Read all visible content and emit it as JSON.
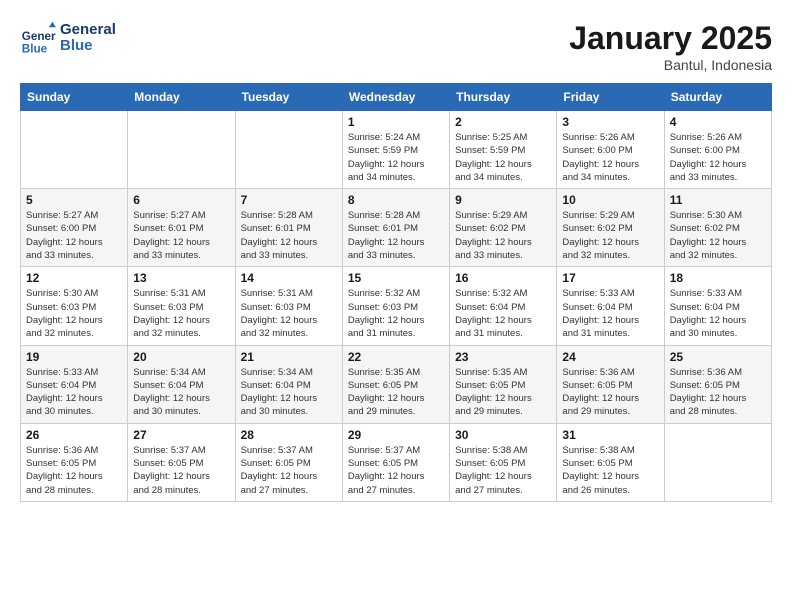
{
  "header": {
    "logo_line1": "General",
    "logo_line2": "Blue",
    "month_title": "January 2025",
    "location": "Bantul, Indonesia"
  },
  "weekdays": [
    "Sunday",
    "Monday",
    "Tuesday",
    "Wednesday",
    "Thursday",
    "Friday",
    "Saturday"
  ],
  "weeks": [
    [
      {
        "day": "",
        "info": ""
      },
      {
        "day": "",
        "info": ""
      },
      {
        "day": "",
        "info": ""
      },
      {
        "day": "1",
        "info": "Sunrise: 5:24 AM\nSunset: 5:59 PM\nDaylight: 12 hours\nand 34 minutes."
      },
      {
        "day": "2",
        "info": "Sunrise: 5:25 AM\nSunset: 5:59 PM\nDaylight: 12 hours\nand 34 minutes."
      },
      {
        "day": "3",
        "info": "Sunrise: 5:26 AM\nSunset: 6:00 PM\nDaylight: 12 hours\nand 34 minutes."
      },
      {
        "day": "4",
        "info": "Sunrise: 5:26 AM\nSunset: 6:00 PM\nDaylight: 12 hours\nand 33 minutes."
      }
    ],
    [
      {
        "day": "5",
        "info": "Sunrise: 5:27 AM\nSunset: 6:00 PM\nDaylight: 12 hours\nand 33 minutes."
      },
      {
        "day": "6",
        "info": "Sunrise: 5:27 AM\nSunset: 6:01 PM\nDaylight: 12 hours\nand 33 minutes."
      },
      {
        "day": "7",
        "info": "Sunrise: 5:28 AM\nSunset: 6:01 PM\nDaylight: 12 hours\nand 33 minutes."
      },
      {
        "day": "8",
        "info": "Sunrise: 5:28 AM\nSunset: 6:01 PM\nDaylight: 12 hours\nand 33 minutes."
      },
      {
        "day": "9",
        "info": "Sunrise: 5:29 AM\nSunset: 6:02 PM\nDaylight: 12 hours\nand 33 minutes."
      },
      {
        "day": "10",
        "info": "Sunrise: 5:29 AM\nSunset: 6:02 PM\nDaylight: 12 hours\nand 32 minutes."
      },
      {
        "day": "11",
        "info": "Sunrise: 5:30 AM\nSunset: 6:02 PM\nDaylight: 12 hours\nand 32 minutes."
      }
    ],
    [
      {
        "day": "12",
        "info": "Sunrise: 5:30 AM\nSunset: 6:03 PM\nDaylight: 12 hours\nand 32 minutes."
      },
      {
        "day": "13",
        "info": "Sunrise: 5:31 AM\nSunset: 6:03 PM\nDaylight: 12 hours\nand 32 minutes."
      },
      {
        "day": "14",
        "info": "Sunrise: 5:31 AM\nSunset: 6:03 PM\nDaylight: 12 hours\nand 32 minutes."
      },
      {
        "day": "15",
        "info": "Sunrise: 5:32 AM\nSunset: 6:03 PM\nDaylight: 12 hours\nand 31 minutes."
      },
      {
        "day": "16",
        "info": "Sunrise: 5:32 AM\nSunset: 6:04 PM\nDaylight: 12 hours\nand 31 minutes."
      },
      {
        "day": "17",
        "info": "Sunrise: 5:33 AM\nSunset: 6:04 PM\nDaylight: 12 hours\nand 31 minutes."
      },
      {
        "day": "18",
        "info": "Sunrise: 5:33 AM\nSunset: 6:04 PM\nDaylight: 12 hours\nand 30 minutes."
      }
    ],
    [
      {
        "day": "19",
        "info": "Sunrise: 5:33 AM\nSunset: 6:04 PM\nDaylight: 12 hours\nand 30 minutes."
      },
      {
        "day": "20",
        "info": "Sunrise: 5:34 AM\nSunset: 6:04 PM\nDaylight: 12 hours\nand 30 minutes."
      },
      {
        "day": "21",
        "info": "Sunrise: 5:34 AM\nSunset: 6:04 PM\nDaylight: 12 hours\nand 30 minutes."
      },
      {
        "day": "22",
        "info": "Sunrise: 5:35 AM\nSunset: 6:05 PM\nDaylight: 12 hours\nand 29 minutes."
      },
      {
        "day": "23",
        "info": "Sunrise: 5:35 AM\nSunset: 6:05 PM\nDaylight: 12 hours\nand 29 minutes."
      },
      {
        "day": "24",
        "info": "Sunrise: 5:36 AM\nSunset: 6:05 PM\nDaylight: 12 hours\nand 29 minutes."
      },
      {
        "day": "25",
        "info": "Sunrise: 5:36 AM\nSunset: 6:05 PM\nDaylight: 12 hours\nand 28 minutes."
      }
    ],
    [
      {
        "day": "26",
        "info": "Sunrise: 5:36 AM\nSunset: 6:05 PM\nDaylight: 12 hours\nand 28 minutes."
      },
      {
        "day": "27",
        "info": "Sunrise: 5:37 AM\nSunset: 6:05 PM\nDaylight: 12 hours\nand 28 minutes."
      },
      {
        "day": "28",
        "info": "Sunrise: 5:37 AM\nSunset: 6:05 PM\nDaylight: 12 hours\nand 27 minutes."
      },
      {
        "day": "29",
        "info": "Sunrise: 5:37 AM\nSunset: 6:05 PM\nDaylight: 12 hours\nand 27 minutes."
      },
      {
        "day": "30",
        "info": "Sunrise: 5:38 AM\nSunset: 6:05 PM\nDaylight: 12 hours\nand 27 minutes."
      },
      {
        "day": "31",
        "info": "Sunrise: 5:38 AM\nSunset: 6:05 PM\nDaylight: 12 hours\nand 26 minutes."
      },
      {
        "day": "",
        "info": ""
      }
    ]
  ]
}
